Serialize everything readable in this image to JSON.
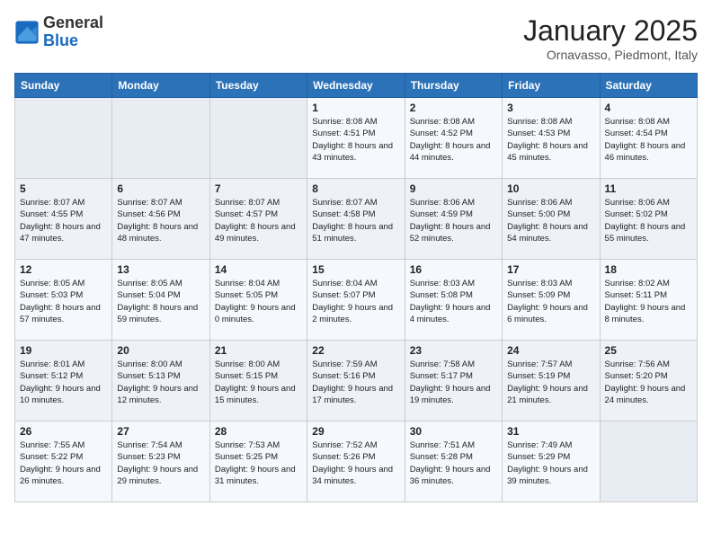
{
  "logo": {
    "general": "General",
    "blue": "Blue"
  },
  "header": {
    "month": "January 2025",
    "location": "Ornavasso, Piedmont, Italy"
  },
  "weekdays": [
    "Sunday",
    "Monday",
    "Tuesday",
    "Wednesday",
    "Thursday",
    "Friday",
    "Saturday"
  ],
  "weeks": [
    [
      {
        "day": "",
        "content": ""
      },
      {
        "day": "",
        "content": ""
      },
      {
        "day": "",
        "content": ""
      },
      {
        "day": "1",
        "content": "Sunrise: 8:08 AM\nSunset: 4:51 PM\nDaylight: 8 hours and 43 minutes."
      },
      {
        "day": "2",
        "content": "Sunrise: 8:08 AM\nSunset: 4:52 PM\nDaylight: 8 hours and 44 minutes."
      },
      {
        "day": "3",
        "content": "Sunrise: 8:08 AM\nSunset: 4:53 PM\nDaylight: 8 hours and 45 minutes."
      },
      {
        "day": "4",
        "content": "Sunrise: 8:08 AM\nSunset: 4:54 PM\nDaylight: 8 hours and 46 minutes."
      }
    ],
    [
      {
        "day": "5",
        "content": "Sunrise: 8:07 AM\nSunset: 4:55 PM\nDaylight: 8 hours and 47 minutes."
      },
      {
        "day": "6",
        "content": "Sunrise: 8:07 AM\nSunset: 4:56 PM\nDaylight: 8 hours and 48 minutes."
      },
      {
        "day": "7",
        "content": "Sunrise: 8:07 AM\nSunset: 4:57 PM\nDaylight: 8 hours and 49 minutes."
      },
      {
        "day": "8",
        "content": "Sunrise: 8:07 AM\nSunset: 4:58 PM\nDaylight: 8 hours and 51 minutes."
      },
      {
        "day": "9",
        "content": "Sunrise: 8:06 AM\nSunset: 4:59 PM\nDaylight: 8 hours and 52 minutes."
      },
      {
        "day": "10",
        "content": "Sunrise: 8:06 AM\nSunset: 5:00 PM\nDaylight: 8 hours and 54 minutes."
      },
      {
        "day": "11",
        "content": "Sunrise: 8:06 AM\nSunset: 5:02 PM\nDaylight: 8 hours and 55 minutes."
      }
    ],
    [
      {
        "day": "12",
        "content": "Sunrise: 8:05 AM\nSunset: 5:03 PM\nDaylight: 8 hours and 57 minutes."
      },
      {
        "day": "13",
        "content": "Sunrise: 8:05 AM\nSunset: 5:04 PM\nDaylight: 8 hours and 59 minutes."
      },
      {
        "day": "14",
        "content": "Sunrise: 8:04 AM\nSunset: 5:05 PM\nDaylight: 9 hours and 0 minutes."
      },
      {
        "day": "15",
        "content": "Sunrise: 8:04 AM\nSunset: 5:07 PM\nDaylight: 9 hours and 2 minutes."
      },
      {
        "day": "16",
        "content": "Sunrise: 8:03 AM\nSunset: 5:08 PM\nDaylight: 9 hours and 4 minutes."
      },
      {
        "day": "17",
        "content": "Sunrise: 8:03 AM\nSunset: 5:09 PM\nDaylight: 9 hours and 6 minutes."
      },
      {
        "day": "18",
        "content": "Sunrise: 8:02 AM\nSunset: 5:11 PM\nDaylight: 9 hours and 8 minutes."
      }
    ],
    [
      {
        "day": "19",
        "content": "Sunrise: 8:01 AM\nSunset: 5:12 PM\nDaylight: 9 hours and 10 minutes."
      },
      {
        "day": "20",
        "content": "Sunrise: 8:00 AM\nSunset: 5:13 PM\nDaylight: 9 hours and 12 minutes."
      },
      {
        "day": "21",
        "content": "Sunrise: 8:00 AM\nSunset: 5:15 PM\nDaylight: 9 hours and 15 minutes."
      },
      {
        "day": "22",
        "content": "Sunrise: 7:59 AM\nSunset: 5:16 PM\nDaylight: 9 hours and 17 minutes."
      },
      {
        "day": "23",
        "content": "Sunrise: 7:58 AM\nSunset: 5:17 PM\nDaylight: 9 hours and 19 minutes."
      },
      {
        "day": "24",
        "content": "Sunrise: 7:57 AM\nSunset: 5:19 PM\nDaylight: 9 hours and 21 minutes."
      },
      {
        "day": "25",
        "content": "Sunrise: 7:56 AM\nSunset: 5:20 PM\nDaylight: 9 hours and 24 minutes."
      }
    ],
    [
      {
        "day": "26",
        "content": "Sunrise: 7:55 AM\nSunset: 5:22 PM\nDaylight: 9 hours and 26 minutes."
      },
      {
        "day": "27",
        "content": "Sunrise: 7:54 AM\nSunset: 5:23 PM\nDaylight: 9 hours and 29 minutes."
      },
      {
        "day": "28",
        "content": "Sunrise: 7:53 AM\nSunset: 5:25 PM\nDaylight: 9 hours and 31 minutes."
      },
      {
        "day": "29",
        "content": "Sunrise: 7:52 AM\nSunset: 5:26 PM\nDaylight: 9 hours and 34 minutes."
      },
      {
        "day": "30",
        "content": "Sunrise: 7:51 AM\nSunset: 5:28 PM\nDaylight: 9 hours and 36 minutes."
      },
      {
        "day": "31",
        "content": "Sunrise: 7:49 AM\nSunset: 5:29 PM\nDaylight: 9 hours and 39 minutes."
      },
      {
        "day": "",
        "content": ""
      }
    ]
  ]
}
